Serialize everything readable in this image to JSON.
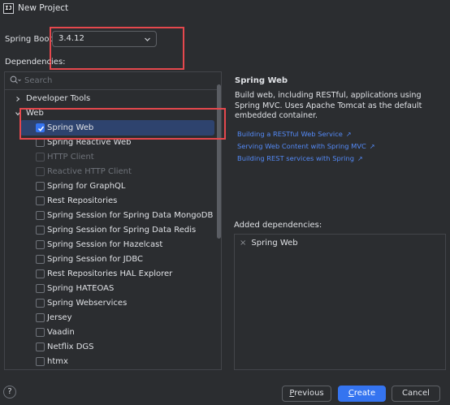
{
  "window": {
    "title": "New Project",
    "app_icon": "IJ"
  },
  "spring_boot": {
    "label": "Spring Boot:",
    "version": "3.4.12"
  },
  "dependencies_label": "Dependencies:",
  "search": {
    "placeholder": "Search"
  },
  "tree": {
    "developer_tools": "Developer Tools",
    "web": "Web",
    "items": [
      {
        "label": "Spring Web",
        "checked": true,
        "enabled": true
      },
      {
        "label": "Spring Reactive Web",
        "checked": false,
        "enabled": true
      },
      {
        "label": "HTTP Client",
        "checked": false,
        "enabled": false
      },
      {
        "label": "Reactive HTTP Client",
        "checked": false,
        "enabled": false
      },
      {
        "label": "Spring for GraphQL",
        "checked": false,
        "enabled": true
      },
      {
        "label": "Rest Repositories",
        "checked": false,
        "enabled": true
      },
      {
        "label": "Spring Session for Spring Data MongoDB",
        "checked": false,
        "enabled": true
      },
      {
        "label": "Spring Session for Spring Data Redis",
        "checked": false,
        "enabled": true
      },
      {
        "label": "Spring Session for Hazelcast",
        "checked": false,
        "enabled": true
      },
      {
        "label": "Spring Session for JDBC",
        "checked": false,
        "enabled": true
      },
      {
        "label": "Rest Repositories HAL Explorer",
        "checked": false,
        "enabled": true
      },
      {
        "label": "Spring HATEOAS",
        "checked": false,
        "enabled": true
      },
      {
        "label": "Spring Webservices",
        "checked": false,
        "enabled": true
      },
      {
        "label": "Jersey",
        "checked": false,
        "enabled": true
      },
      {
        "label": "Vaadin",
        "checked": false,
        "enabled": true
      },
      {
        "label": "Netflix DGS",
        "checked": false,
        "enabled": true
      },
      {
        "label": "htmx",
        "checked": false,
        "enabled": true
      }
    ]
  },
  "detail": {
    "title": "Spring Web",
    "description": "Build web, including RESTful, applications using Spring MVC. Uses Apache Tomcat as the default embedded container.",
    "links": [
      "Building a RESTful Web Service",
      "Serving Web Content with Spring MVC",
      "Building REST services with Spring"
    ],
    "link_arrow": "↗"
  },
  "added": {
    "label": "Added dependencies:",
    "items": [
      "Spring Web"
    ],
    "remove_glyph": "×"
  },
  "footer": {
    "help": "?",
    "previous": {
      "mnemonic": "P",
      "rest": "revious"
    },
    "create": {
      "mnemonic": "C",
      "rest": "reate"
    },
    "cancel": "Cancel"
  },
  "colors": {
    "accent": "#3574f0",
    "link": "#548af7",
    "highlight": "#e5484d",
    "background": "#2b2d30"
  },
  "icons": [
    "app-icon",
    "chevron-down-icon",
    "search-icon",
    "chevron-right-icon",
    "chevron-down-icon",
    "checkmark-icon",
    "external-link-icon",
    "remove-icon",
    "help-icon"
  ]
}
